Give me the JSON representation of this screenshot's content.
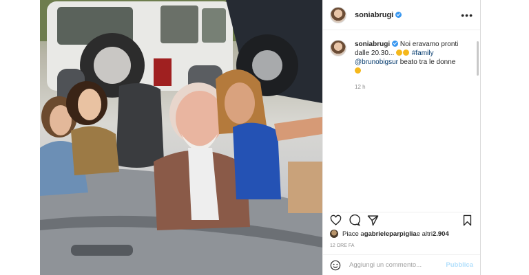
{
  "post": {
    "username": "soniabrugi",
    "more_label": "•••",
    "caption": {
      "text_before": "Noi eravamo pronti dalle 20.30...",
      "hashtag": "#family",
      "mention": "@brunobigsur",
      "text_after": " beato tra le donne",
      "time": "12 h"
    },
    "likes": {
      "prefix": "Piace a ",
      "user": "gabrieleparpiglia",
      "suffix": " e altri ",
      "count": "2.904"
    },
    "posted_ago": "12 ORE FA",
    "comment": {
      "placeholder": "Aggiungi un commento...",
      "publish_label": "Pubblica"
    },
    "icons": {
      "like": "heart-icon",
      "comment": "comment-icon",
      "share": "share-icon",
      "save": "bookmark-icon",
      "emoji": "smiley-icon"
    },
    "colors": {
      "verified": "#3897f0",
      "publish": "#b2dffc",
      "link": "#00376b"
    }
  }
}
